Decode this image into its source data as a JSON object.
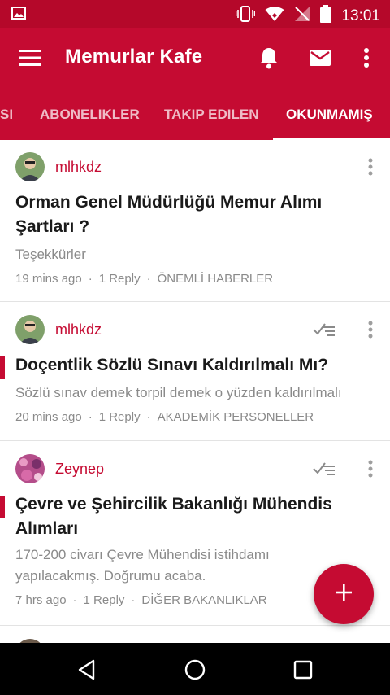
{
  "status_bar": {
    "time": "13:01"
  },
  "app_bar": {
    "title": "Memurlar Kafe"
  },
  "tabs": [
    {
      "label": "SI"
    },
    {
      "label": "ABONELIKLER"
    },
    {
      "label": "TAKIP EDILEN"
    },
    {
      "label": "OKUNMAMIŞ"
    }
  ],
  "active_tab": "OKUNMAMIŞ",
  "colors": {
    "accent": "#c50b32",
    "status_bar": "#b5082a",
    "muted_text": "#8a8a8a"
  },
  "topics": [
    {
      "author": "mlhkdz",
      "title": "Orman Genel Müdürlüğü Memur Alımı Şartları ?",
      "excerpt": "Teşekkürler",
      "time": "19 mins ago",
      "replies": "1 Reply",
      "category": "ÖNEMLİ HABERLER",
      "unread": false
    },
    {
      "author": "mlhkdz",
      "title": "Doçentlik Sözlü Sınavı Kaldırılmalı Mı?",
      "excerpt": "Sözlü sınav demek torpil demek o yüzden kaldırılmalı",
      "time": "20 mins ago",
      "replies": "1 Reply",
      "category": "AKADEMİK PERSONELLER",
      "unread": true
    },
    {
      "author": "Zeynep",
      "title": "Çevre ve Şehircilik Bakanlığı Mühendis Alımları",
      "excerpt": "170-200 civarı Çevre Mühendisi istihdamı yapılacakmış. Doğrumu acaba.",
      "time": "7 hrs ago",
      "replies": "1 Reply",
      "category": "DİĞER BAKANLIKLAR",
      "unread": true
    }
  ],
  "icons": {
    "menu": "menu-icon",
    "notifications": "bell-icon",
    "messages": "mail-icon",
    "overflow": "more-vert-icon",
    "mark_read": "mark-read-icon",
    "compose": "plus-icon",
    "back": "back-triangle-icon",
    "home": "home-circle-icon",
    "recents": "recents-square-icon"
  }
}
